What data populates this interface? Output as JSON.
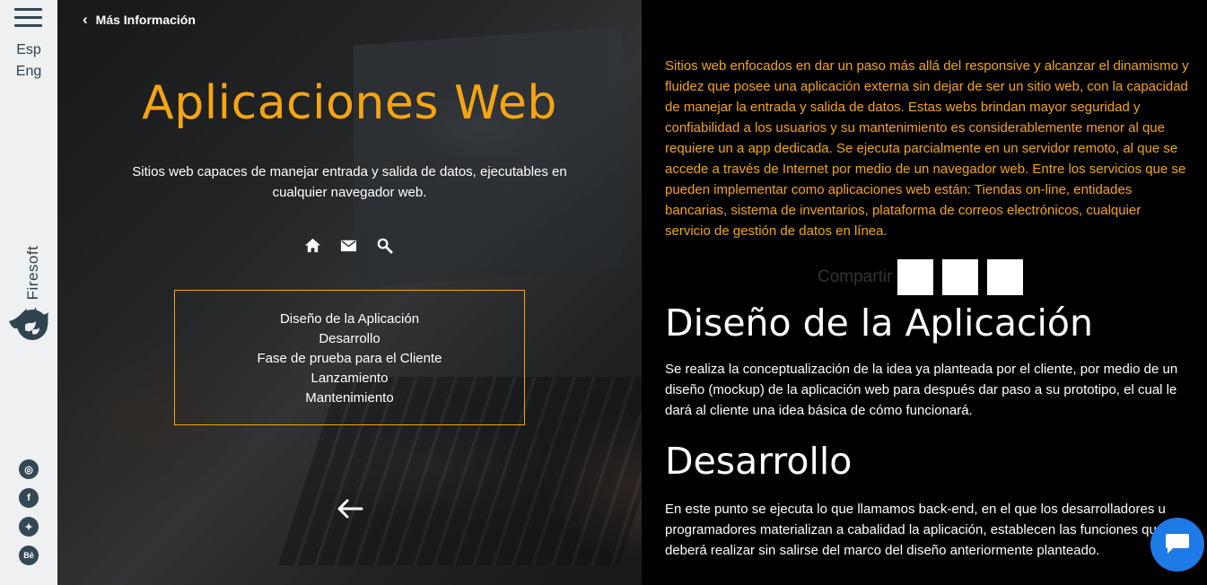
{
  "sidebar": {
    "languages": [
      "Esp",
      "Eng"
    ],
    "brand_name": "Firesoft",
    "social": [
      {
        "name": "instagram-icon",
        "glyph": "◎"
      },
      {
        "name": "facebook-icon",
        "glyph": "f"
      },
      {
        "name": "twitter-icon",
        "glyph": "✦"
      },
      {
        "name": "behance-icon",
        "glyph": "Bē"
      }
    ]
  },
  "hero": {
    "back_label": "Más Información",
    "title": "Aplicaciones Web",
    "subtitle": "Sitios web capaces de manejar entrada y salida de datos, ejecutables en cualquier navegador web.",
    "icons": [
      "home-icon",
      "mail-icon",
      "search-icon"
    ],
    "toc": [
      "Diseño de la Aplicación",
      "Desarrollo",
      "Fase de prueba para el Cliente",
      "Lanzamiento",
      "Mantenimiento"
    ]
  },
  "content": {
    "intro": "Sitios web enfocados en dar un paso más allá del responsive y alcanzar el dinamismo y fluidez que posee una aplicación externa sin dejar de ser un sitio web, con la capacidad de manejar la entrada y salida de datos. Estas webs brindan mayor seguridad y confiabilidad a los usuarios y su mantenimiento es considerablemente menor al que requiere un a app dedicada. Se ejecuta parcialmente en un servidor remoto, al que se accede a través de Internet por medio de un navegador web. Entre los servicios que se pueden implementar como aplicaciones web están: Tiendas on-line, entidades bancarias, sistema de inventarios, plataforma de correos electrónicos, cualquier servicio de gestión de datos en línea.",
    "share_label": "Compartir",
    "sections": [
      {
        "title": "Diseño de la Aplicación",
        "text": "Se realiza la conceptualización de la idea ya planteada por el cliente, por medio de un diseño (mockup) de la aplicación web para después dar paso a su prototipo, el cual le dará al cliente una idea básica de cómo funcionará."
      },
      {
        "title": "Desarrollo",
        "text": "En este punto se ejecuta lo que llamamos back-end, en el que los desarrolladores u programadores materializan a cabalidad la aplicación, establecen las funciones que deberá realizar sin salirse del marco del diseño anteriormente planteado."
      }
    ]
  },
  "colors": {
    "accent": "#f5a512",
    "sidebar_bg": "#eef0f1",
    "sidebar_fg": "#334855",
    "chat": "#1d7ae6"
  }
}
